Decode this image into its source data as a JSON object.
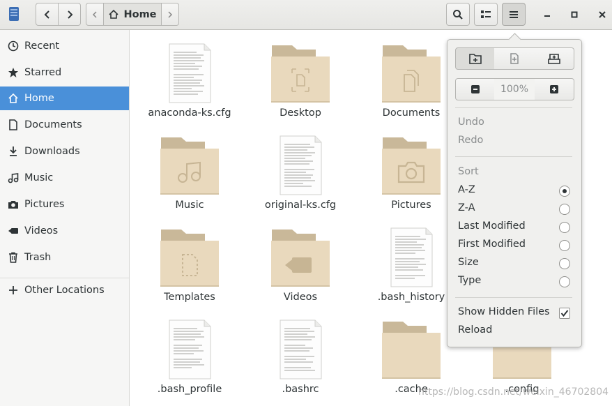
{
  "headerbar": {
    "path_current": "Home",
    "icons": [
      "files-app-icon",
      "back-arrow-icon",
      "forward-arrow-icon",
      "path-left-icon",
      "home-icon",
      "path-right-icon",
      "search-icon",
      "view-list-icon",
      "menu-icon",
      "minimize-icon",
      "maximize-icon",
      "close-icon"
    ]
  },
  "sidebar": {
    "items": [
      {
        "label": "Recent",
        "icon": "clock-icon"
      },
      {
        "label": "Starred",
        "icon": "star-icon"
      },
      {
        "label": "Home",
        "icon": "home-icon",
        "active": true
      },
      {
        "label": "Documents",
        "icon": "document-icon"
      },
      {
        "label": "Downloads",
        "icon": "download-icon"
      },
      {
        "label": "Music",
        "icon": "music-icon"
      },
      {
        "label": "Pictures",
        "icon": "camera-icon"
      },
      {
        "label": "Videos",
        "icon": "video-icon"
      },
      {
        "label": "Trash",
        "icon": "trash-icon"
      }
    ],
    "other_locations": "Other Locations"
  },
  "files": [
    {
      "name": "anaconda-ks.cfg",
      "kind": "text"
    },
    {
      "name": "Desktop",
      "kind": "folder",
      "emblem": "desktop"
    },
    {
      "name": "Documents",
      "kind": "folder",
      "emblem": "documents"
    },
    {
      "name": "Music",
      "kind": "folder",
      "emblem": "music"
    },
    {
      "name": "original-ks.cfg",
      "kind": "text"
    },
    {
      "name": "Pictures",
      "kind": "folder",
      "emblem": "pictures"
    },
    {
      "name": "Templates",
      "kind": "folder",
      "emblem": "templates"
    },
    {
      "name": "Videos",
      "kind": "folder",
      "emblem": "videos"
    },
    {
      "name": ".bash_history",
      "kind": "text"
    },
    {
      "name": ".bash_profile",
      "kind": "text"
    },
    {
      "name": ".bashrc",
      "kind": "text"
    },
    {
      "name": ".cache",
      "kind": "folder",
      "emblem": "none"
    },
    {
      "name": ".config",
      "kind": "folder",
      "emblem": "none"
    }
  ],
  "menu": {
    "zoom": "100%",
    "undo": "Undo",
    "redo": "Redo",
    "sort_header": "Sort",
    "sort_options": [
      {
        "label": "A-Z",
        "selected": true
      },
      {
        "label": "Z-A",
        "selected": false
      },
      {
        "label": "Last Modified",
        "selected": false
      },
      {
        "label": "First Modified",
        "selected": false
      },
      {
        "label": "Size",
        "selected": false
      },
      {
        "label": "Type",
        "selected": false
      }
    ],
    "show_hidden": "Show Hidden Files",
    "show_hidden_checked": true,
    "reload": "Reload"
  },
  "watermark": "https://blog.csdn.net/weixin_46702804",
  "colors": {
    "accent": "#4a90d9",
    "folder": "#e9d9bd",
    "folder_tab": "#c9b899"
  }
}
